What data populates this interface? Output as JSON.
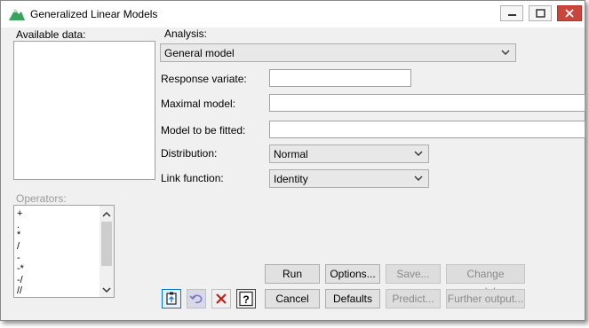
{
  "window": {
    "title": "Generalized Linear Models",
    "controls": [
      "minimize-icon",
      "maximize-icon",
      "close-icon"
    ]
  },
  "left": {
    "available_label": "Available data:",
    "operators_label": "Operators:",
    "operators": [
      "+",
      ".",
      "*",
      "/",
      "-",
      "-*",
      "-/",
      "//"
    ]
  },
  "form": {
    "analysis_label": "Analysis:",
    "analysis_value": "General model",
    "response_label": "Response variate:",
    "response_value": "",
    "maximal_label": "Maximal model:",
    "maximal_value": "",
    "fitted_label": "Model to be fitted:",
    "fitted_value": "",
    "distribution_label": "Distribution:",
    "distribution_value": "Normal",
    "link_label": "Link function:",
    "link_value": "Identity"
  },
  "buttons": {
    "run": "Run",
    "options": "Options...",
    "save": "Save...",
    "change_model": "Change model...",
    "cancel": "Cancel",
    "defaults": "Defaults",
    "predict": "Predict...",
    "further_output": "Further output..."
  },
  "icon_buttons": [
    "clipboard-icon",
    "undo-icon",
    "clear-icon",
    "help-icon"
  ],
  "colors": {
    "close_button": "#c9463d",
    "accent": "#0078d7"
  }
}
